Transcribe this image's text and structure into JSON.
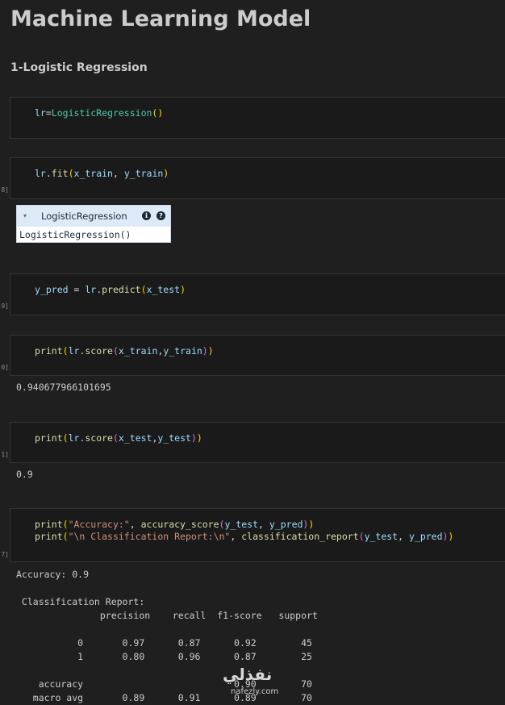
{
  "heading": "Machine Learning Model",
  "subheading": "1-Logistic Regression",
  "cells": [
    {
      "exec": "",
      "lines": [
        [
          {
            "t": "lr",
            "c": "var"
          },
          {
            "t": "=",
            "c": "op"
          },
          {
            "t": "LogisticRegression",
            "c": "cls"
          },
          {
            "t": "()",
            "c": "p1"
          }
        ]
      ]
    },
    {
      "exec": "8]",
      "lines": [
        [
          {
            "t": "lr",
            "c": "var"
          },
          {
            "t": ".",
            "c": "op"
          },
          {
            "t": "fit",
            "c": "fn"
          },
          {
            "t": "(",
            "c": "p1"
          },
          {
            "t": "x_train",
            "c": "var"
          },
          {
            "t": ", ",
            "c": "op"
          },
          {
            "t": "y_train",
            "c": "var"
          },
          {
            "t": ")",
            "c": "p1"
          }
        ]
      ]
    },
    {
      "exec": "9]",
      "lines": [
        [
          {
            "t": "y_pred",
            "c": "var"
          },
          {
            "t": " = ",
            "c": "op"
          },
          {
            "t": "lr",
            "c": "var"
          },
          {
            "t": ".",
            "c": "op"
          },
          {
            "t": "predict",
            "c": "fn"
          },
          {
            "t": "(",
            "c": "p1"
          },
          {
            "t": "x_test",
            "c": "var"
          },
          {
            "t": ")",
            "c": "p1"
          }
        ]
      ]
    },
    {
      "exec": "0]",
      "lines": [
        [
          {
            "t": "print",
            "c": "fn"
          },
          {
            "t": "(",
            "c": "p1"
          },
          {
            "t": "lr",
            "c": "var"
          },
          {
            "t": ".",
            "c": "op"
          },
          {
            "t": "score",
            "c": "fn"
          },
          {
            "t": "(",
            "c": "p2"
          },
          {
            "t": "x_train",
            "c": "var"
          },
          {
            "t": ",",
            "c": "op"
          },
          {
            "t": "y_train",
            "c": "var"
          },
          {
            "t": ")",
            "c": "p2"
          },
          {
            "t": ")",
            "c": "p1"
          }
        ]
      ]
    },
    {
      "exec": "1]",
      "lines": [
        [
          {
            "t": "print",
            "c": "fn"
          },
          {
            "t": "(",
            "c": "p1"
          },
          {
            "t": "lr",
            "c": "var"
          },
          {
            "t": ".",
            "c": "op"
          },
          {
            "t": "score",
            "c": "fn"
          },
          {
            "t": "(",
            "c": "p2"
          },
          {
            "t": "x_test",
            "c": "var"
          },
          {
            "t": ",",
            "c": "op"
          },
          {
            "t": "y_test",
            "c": "var"
          },
          {
            "t": ")",
            "c": "p2"
          },
          {
            "t": ")",
            "c": "p1"
          }
        ]
      ]
    },
    {
      "exec": "7]",
      "lines": [
        [
          {
            "t": "print",
            "c": "fn"
          },
          {
            "t": "(",
            "c": "p1"
          },
          {
            "t": "\"Accuracy:\"",
            "c": "str"
          },
          {
            "t": ", ",
            "c": "op"
          },
          {
            "t": "accuracy_score",
            "c": "fn"
          },
          {
            "t": "(",
            "c": "p2"
          },
          {
            "t": "y_test",
            "c": "var"
          },
          {
            "t": ", ",
            "c": "op"
          },
          {
            "t": "y_pred",
            "c": "var"
          },
          {
            "t": ")",
            "c": "p2"
          },
          {
            "t": ")",
            "c": "p1"
          }
        ],
        [
          {
            "t": "print",
            "c": "fn"
          },
          {
            "t": "(",
            "c": "p1"
          },
          {
            "t": "\"\\n Classification Report:\\n\"",
            "c": "str"
          },
          {
            "t": ", ",
            "c": "op"
          },
          {
            "t": "classification_report",
            "c": "fn"
          },
          {
            "t": "(",
            "c": "p2"
          },
          {
            "t": "y_test",
            "c": "var"
          },
          {
            "t": ", ",
            "c": "op"
          },
          {
            "t": "y_pred",
            "c": "var"
          },
          {
            "t": ")",
            "c": "p2"
          },
          {
            "t": ")",
            "c": "p1"
          }
        ]
      ]
    }
  ],
  "widget": {
    "chevron": "▾",
    "title": "LogisticRegression",
    "info": "i",
    "help": "?",
    "body": "LogisticRegression()"
  },
  "outputs": {
    "train_score": "0.940677966101695",
    "test_score": "0.9",
    "report": "Accuracy: 0.9\n\n Classification Report:\n               precision    recall  f1-score   support\n\n           0       0.97      0.87      0.92        45\n           1       0.80      0.96      0.87        25\n\n    accuracy                           0.90        70\n   macro avg       0.89      0.91      0.89        70"
  },
  "watermark": {
    "logo": "نفذلي",
    "url": "nafezly.com"
  }
}
